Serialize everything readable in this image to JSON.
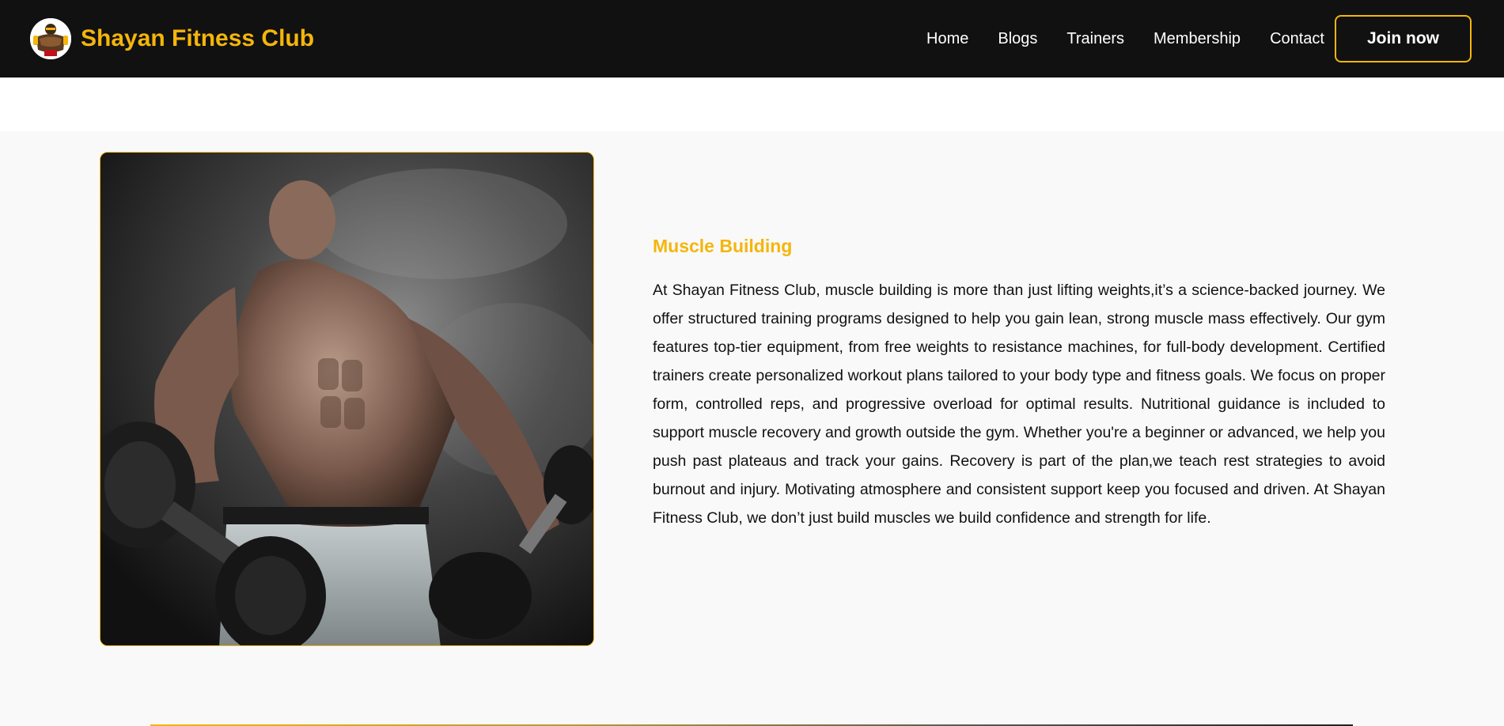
{
  "header": {
    "brand_name": "Shayan Fitness Club",
    "logo_icon": "bodybuilder-mascot-icon",
    "nav": [
      {
        "label": "Home"
      },
      {
        "label": "Blogs"
      },
      {
        "label": "Trainers"
      },
      {
        "label": "Membership"
      },
      {
        "label": "Contact"
      }
    ],
    "cta_label": "Join now"
  },
  "feature": {
    "image_subject": "muscular man holding dumbbells in smoke",
    "title": "Muscle Building",
    "body": "At Shayan Fitness Club, muscle building is more than just lifting weights,it’s a science-backed journey. We offer structured training programs designed to help you gain lean, strong muscle mass effectively. Our gym features top-tier equipment, from free weights to resistance machines, for full-body development. Certified trainers create personalized workout plans tailored to your body type and fitness goals. We focus on proper form, controlled reps, and progressive overload for optimal results. Nutritional guidance is included to support muscle recovery and growth outside the gym. Whether you're a beginner or advanced, we help you push past plateaus and track your gains. Recovery is part of the plan,we teach rest strategies to avoid burnout and injury. Motivating atmosphere and consistent support keep you focused and driven. At Shayan Fitness Club, we don’t just build muscles we build confidence and strength for life."
  },
  "colors": {
    "accent": "#f5b50a",
    "nav_background": "#111111",
    "section_background": "#f9f9f9"
  }
}
